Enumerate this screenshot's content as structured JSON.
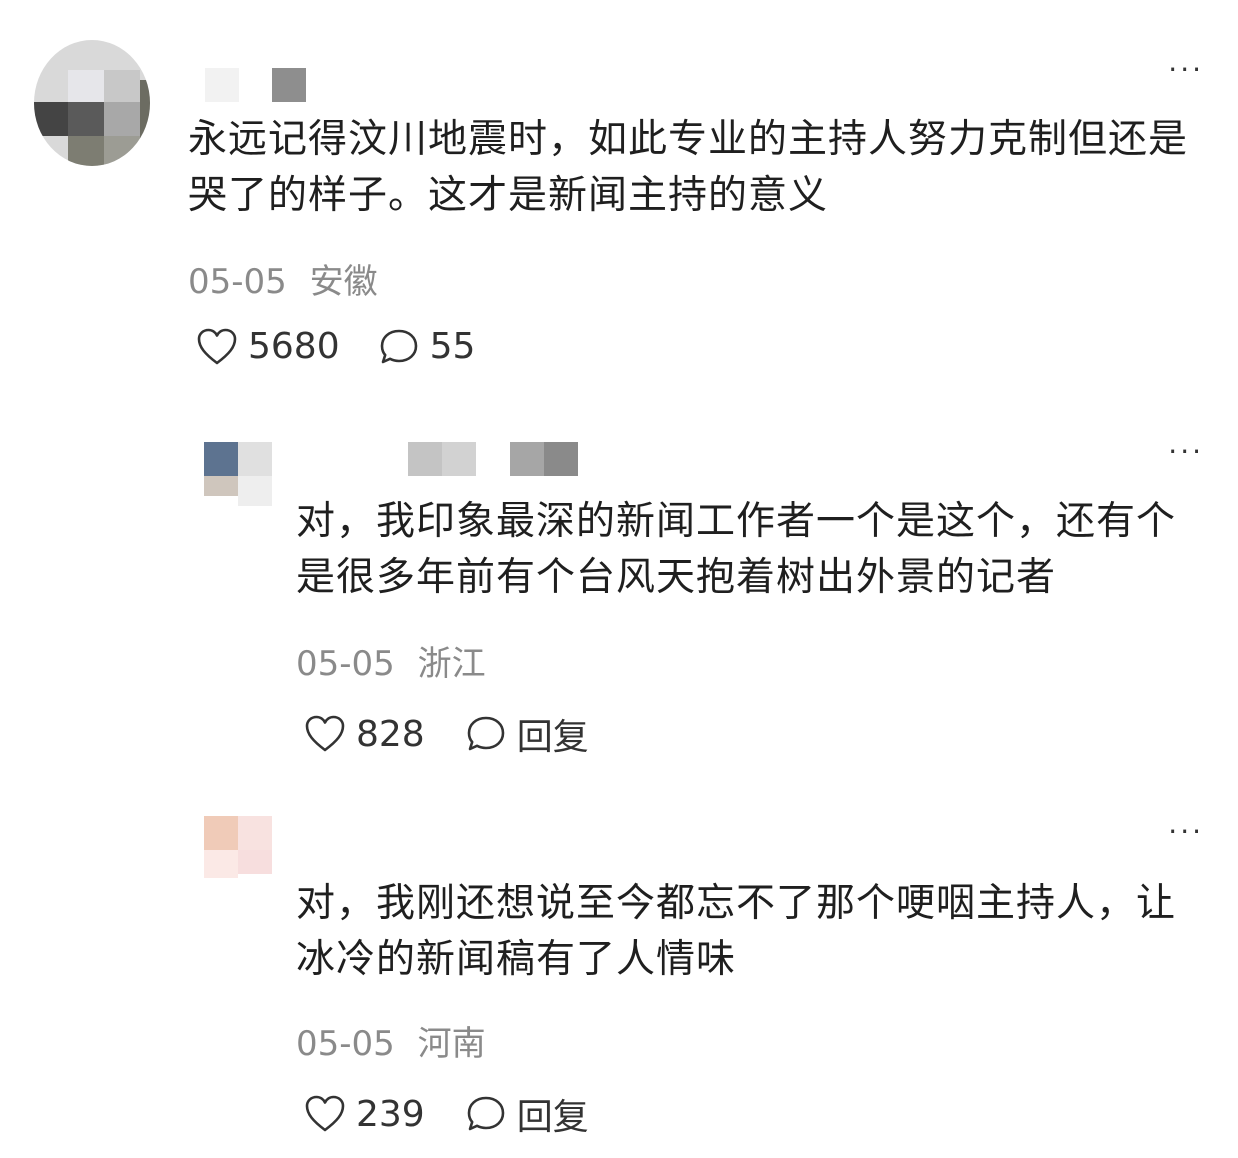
{
  "comments": [
    {
      "text": "永远记得汶川地震时，如此专业的主持人努力克制但还是哭了的样子。这才是新闻主持的意义",
      "date": "05-05",
      "location": "安徽",
      "likes": "5680",
      "comment_count": "55"
    },
    {
      "text": "对，我印象最深的新闻工作者一个是这个，还有个是很多年前有个台风天抱着树出外景的记者",
      "date": "05-05",
      "location": "浙江",
      "likes": "828",
      "reply_label": "回复"
    },
    {
      "text": "对，我刚还想说至今都忘不了那个哽咽主持人，让冰冷的新闻稿有了人情味",
      "date": "05-05",
      "location": "河南",
      "likes": "239",
      "reply_label": "回复"
    }
  ],
  "more_label": "···",
  "icons": {
    "like": "heart-outline-icon",
    "comment": "speech-bubble-icon",
    "more": "more-dots-icon"
  },
  "colors": {
    "meta_text": "#8a8a8a",
    "body_text": "#1f1f1f"
  }
}
